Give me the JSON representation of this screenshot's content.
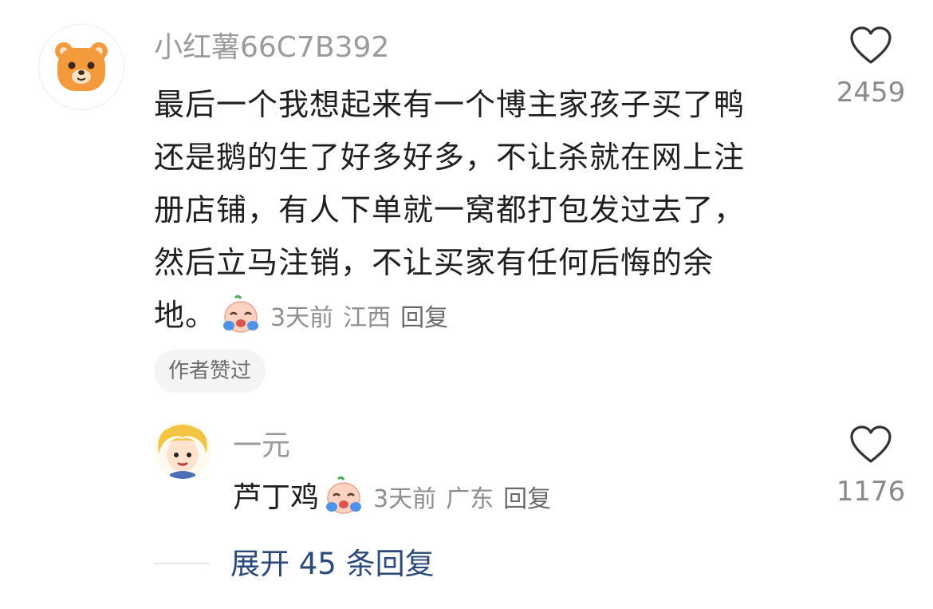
{
  "main_comment": {
    "author": "小红薯66C7B392",
    "lines": [
      "最后一个我想起来有一个博主家孩子买了鸭",
      "还是鹅的生了好多好多，不让杀就在网上注",
      "册店铺，有人下单就一窝都打包发过去了，",
      "然后立马注销，不让买家有任何后悔的余",
      "地。"
    ],
    "emoji": "crying-face-emoji",
    "time": "3天前",
    "location": "江西",
    "reply_label": "回复",
    "badge": "作者赞过",
    "likes": "2459",
    "avatar_icon": "bear-avatar"
  },
  "reply": {
    "author": "一元",
    "text": "芦丁鸡",
    "emoji": "crying-face-emoji",
    "time": "3天前",
    "location": "广东",
    "reply_label": "回复",
    "likes": "1176",
    "avatar_icon": "cartoon-girl-avatar"
  },
  "expand_label": "展开 45 条回复",
  "colors": {
    "accent_link": "#2b4a7a",
    "muted": "#9b9b9b",
    "avatar_bear": "#f39a3c"
  }
}
